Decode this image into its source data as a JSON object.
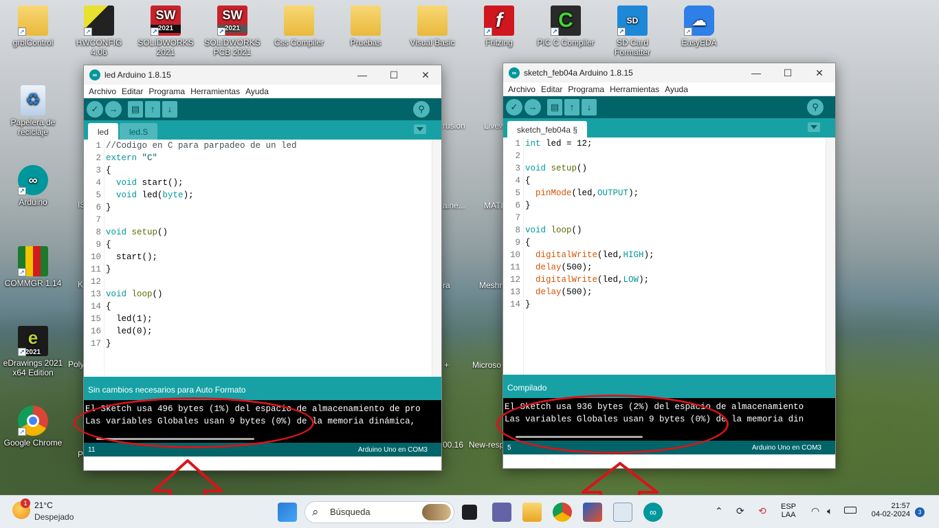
{
  "desktop": {
    "icons": [
      {
        "label": "grblControl",
        "icon": "folder-icon"
      },
      {
        "label": "HWCONFIG 4.06",
        "icon": "hwconfig-icon"
      },
      {
        "label": "SOLIDWORKS 2021",
        "icon": "solidworks-icon",
        "badge": "2021"
      },
      {
        "label": "SOLIDWORKS PCB 2021",
        "icon": "solidworks-pcb-icon",
        "badge": "2021"
      },
      {
        "label": "Css Compiler",
        "icon": "folder-icon"
      },
      {
        "label": "Pruebas",
        "icon": "folder-icon"
      },
      {
        "label": "Visual Basic",
        "icon": "folder-icon"
      },
      {
        "label": "Fritzing",
        "icon": "fritzing-icon"
      },
      {
        "label": "PIC C Compiler",
        "icon": "pic-c-icon"
      },
      {
        "label": "SD Card Formatter",
        "icon": "sd-card-icon"
      },
      {
        "label": "EasyEDA",
        "icon": "easyeda-icon"
      },
      {
        "label": "Papelera de reciclaje",
        "icon": "recycle-bin-icon"
      },
      {
        "label": "Arduino",
        "icon": "arduino-icon"
      },
      {
        "label": "COMMGR 1.14",
        "icon": "commgr-icon"
      },
      {
        "label": "eDrawings 2021 x64 Edition",
        "icon": "edrawings-icon",
        "badge": "2021"
      },
      {
        "label": "Google Chrome",
        "icon": "chrome-icon"
      }
    ],
    "partial_labels": [
      "IS",
      "K",
      "Poly",
      "P",
      "rusion",
      "Livew",
      "aine...",
      "MATL",
      "ra",
      "Meshm",
      "+",
      "Microso",
      "00.16",
      "New-resp"
    ]
  },
  "window_left": {
    "title": "led Arduino 1.8.15",
    "menu": [
      "Archivo",
      "Editar",
      "Programa",
      "Herramientas",
      "Ayuda"
    ],
    "tabs": [
      "led",
      "led.S"
    ],
    "code": [
      "//Codigo en C para parpadeo de un led",
      "extern \"C\"",
      "{",
      "  void start();",
      "  void led(byte);",
      "}",
      "",
      "void setup()",
      "{",
      "  start();",
      "}",
      "",
      "void loop()",
      "{",
      "  led(1);",
      "  led(0);",
      "}"
    ],
    "status": "Sin cambios necesarios para Auto Formato",
    "console": [
      "El Sketch usa 496 bytes (1%) del espacio de almacenamiento de pro",
      "Las variables Globales usan 9 bytes (0%) de la memoria dinámica,"
    ],
    "footer_line": "11",
    "footer_board": "Arduino Uno en COM3"
  },
  "window_right": {
    "title": "sketch_feb04a Arduino 1.8.15",
    "menu": [
      "Archivo",
      "Editar",
      "Programa",
      "Herramientas",
      "Ayuda"
    ],
    "tabs": [
      "sketch_feb04a §"
    ],
    "code": [
      "int led = 12;",
      "",
      "void setup()",
      "{",
      "  pinMode(led,OUTPUT);",
      "}",
      "",
      "void loop()",
      "{",
      "  digitalWrite(led,HIGH);",
      "  delay(500);",
      "  digitalWrite(led,LOW);",
      "  delay(500);",
      "}"
    ],
    "status": "Compilado",
    "console": [
      "El Sketch usa 936 bytes (2%) del espacio de almacenamiento",
      "Las variables Globales usan 9 bytes (0%) de la memoria din"
    ],
    "footer_line": "5",
    "footer_board": "Arduino Uno en COM3"
  },
  "taskbar": {
    "weather_temp": "21°C",
    "weather_desc": "Despejado",
    "weather_badge": "1",
    "search_placeholder": "Búsqueda",
    "lang_top": "ESP",
    "lang_bottom": "LAA",
    "time": "21:57",
    "date": "04-02-2024",
    "notifications": "3"
  },
  "colors": {
    "arduino_dark": "#006468",
    "arduino_mid": "#17a1a5",
    "annotation_red": "#d8141b"
  }
}
